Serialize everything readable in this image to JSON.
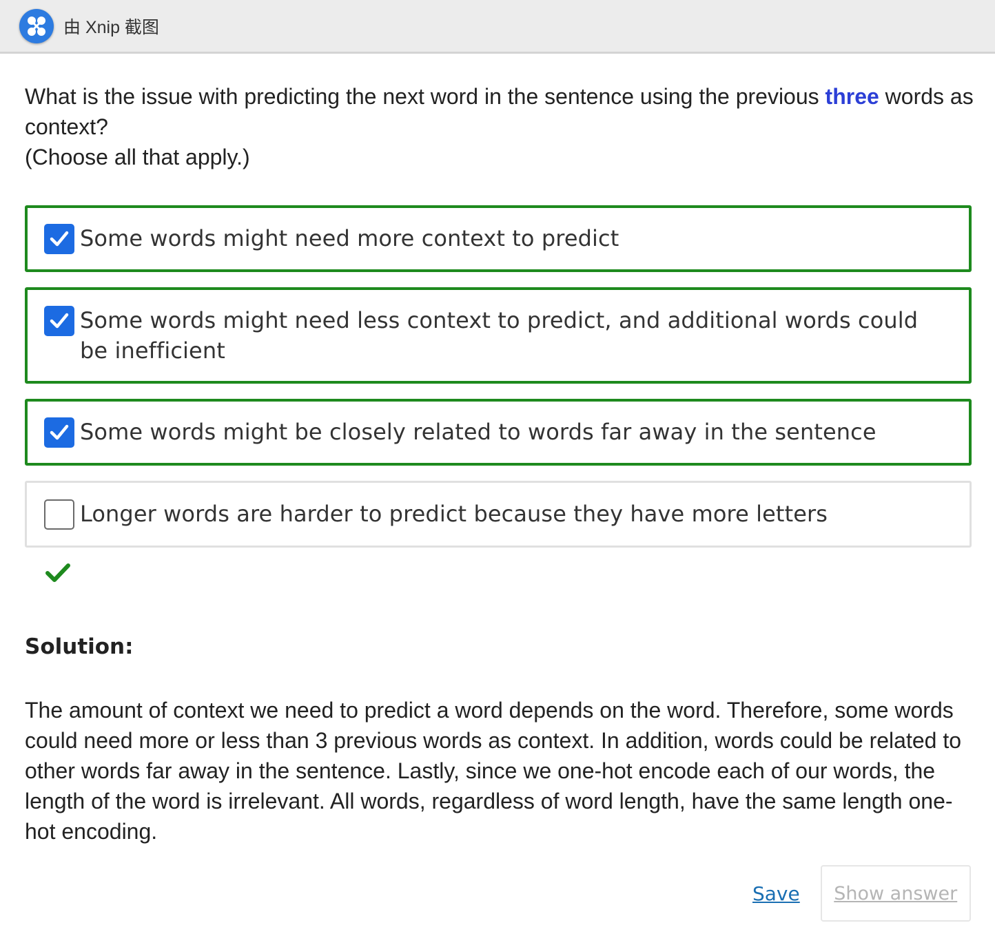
{
  "window": {
    "title": "由 Xnip 截图",
    "logo_icon": "xnip-logo-icon"
  },
  "question": {
    "text_before": "What is the issue with predicting the next word in the sentence using the previous ",
    "highlight": "three",
    "text_after": " words as context?",
    "instruction": "(Choose all that apply.)",
    "highlight_color": "#2c3fd6"
  },
  "options": [
    {
      "label": "Some words might need more context to predict",
      "checked": true
    },
    {
      "label": "Some words might need less context to predict, and additional words could be inefficient",
      "checked": true
    },
    {
      "label": "Some words might be closely related to words far away in the sentence",
      "checked": true
    },
    {
      "label": "Longer words are harder to predict because they have more letters",
      "checked": false
    }
  ],
  "result": {
    "status": "correct",
    "icon": "checkmark-icon",
    "color": "#1e8a1e"
  },
  "solution": {
    "heading": "Solution:",
    "text": "The amount of context we need to predict a word depends on the word. Therefore, some words could need more or less than 3 previous words as context. In addition, words could be related to other words far away in the sentence. Lastly, since we one-hot encode each of our words, the length of the word is irrelevant. All words, regardless of word length, have the same length one-hot encoding."
  },
  "actions": {
    "save_label": "Save",
    "show_answer_label": "Show answer"
  },
  "colors": {
    "checked_border": "#1e8a1e",
    "checkbox_fill": "#1c6be2",
    "link": "#1a6fb3"
  }
}
